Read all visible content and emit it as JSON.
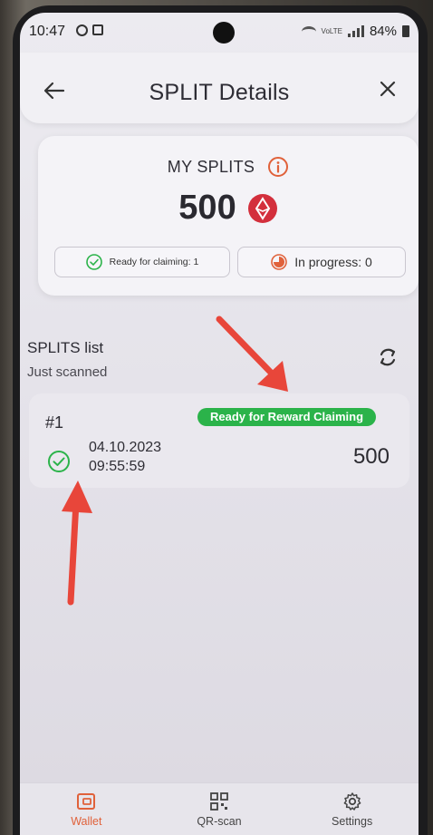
{
  "status_bar": {
    "time": "10:47",
    "network": "VoLTE",
    "battery": "84%"
  },
  "header": {
    "title": "SPLIT Details"
  },
  "summary": {
    "label": "MY SPLITS",
    "amount": "500",
    "ready_label": "Ready for claiming: 1",
    "progress_label": "In progress: 0"
  },
  "list": {
    "title": "SPLITS list",
    "subtitle": "Just scanned",
    "items": [
      {
        "number": "#1",
        "status": "Ready for Reward Claiming",
        "date": "04.10.2023",
        "time": "09:55:59",
        "amount": "500"
      }
    ]
  },
  "nav": {
    "items": [
      {
        "label": "Wallet",
        "icon": "wallet-icon",
        "active": true
      },
      {
        "label": "QR-scan",
        "icon": "qr-icon",
        "active": false
      },
      {
        "label": "Settings",
        "icon": "gear-icon",
        "active": false
      }
    ]
  },
  "colors": {
    "accent": "#e0613a",
    "success": "#2bb34a",
    "token": "#d32f3c",
    "annotation_arrow": "#e8463a"
  }
}
